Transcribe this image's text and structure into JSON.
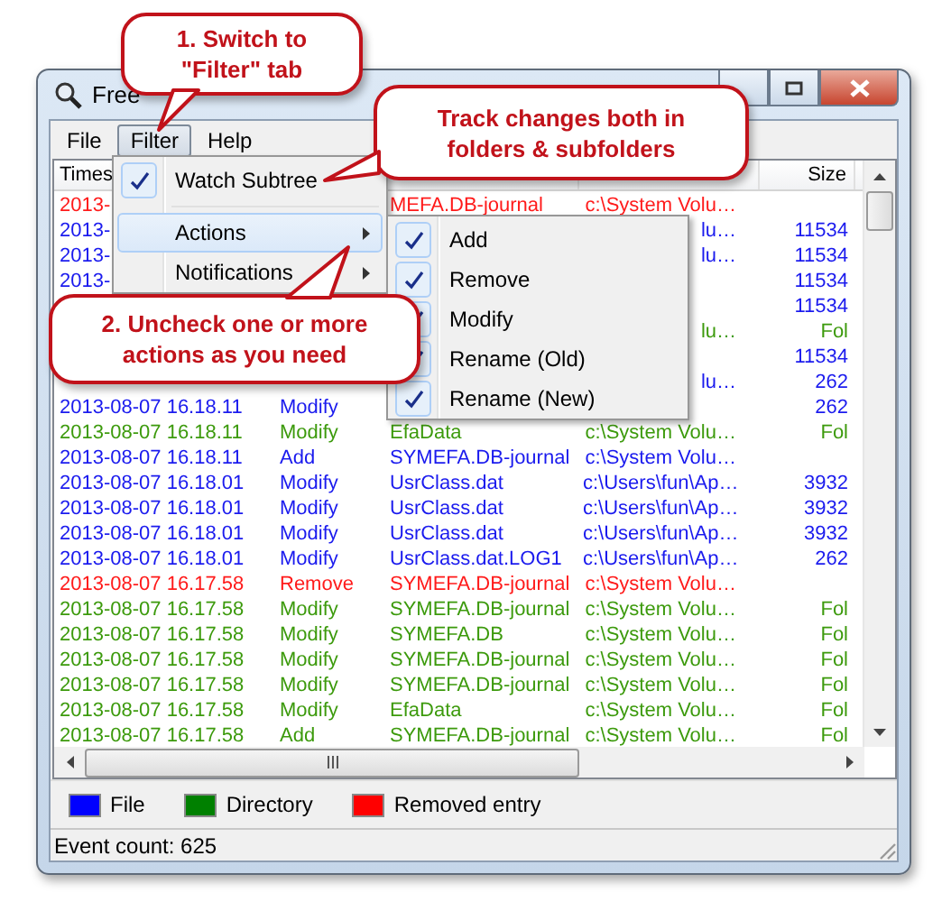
{
  "window": {
    "title": "Free"
  },
  "menu_bar": [
    {
      "label": "File",
      "selected": false
    },
    {
      "label": "Filter",
      "selected": true
    },
    {
      "label": "Help",
      "selected": false
    }
  ],
  "columns": [
    {
      "label": "Times"
    },
    {},
    {},
    {},
    {
      "label": "Size"
    }
  ],
  "rows": [
    {
      "kind": "removed",
      "time": "2013-",
      "name": "MEFA.DB-journal",
      "location": "c:\\System Volu…"
    },
    {
      "kind": "file",
      "time": "2013-",
      "location": "lu…",
      "size": "11534"
    },
    {
      "kind": "file",
      "time": "2013-",
      "location": "lu…",
      "size": "11534"
    },
    {
      "kind": "file",
      "time": "2013-",
      "size": "11534"
    },
    {
      "kind": "file",
      "size": "11534"
    },
    {
      "kind": "directory",
      "location": "lu…",
      "size": "Fol"
    },
    {
      "kind": "file",
      "size": "11534"
    },
    {
      "kind": "file",
      "location": "lu…",
      "size": "262"
    },
    {
      "kind": "file",
      "time": "2013-08-07 16.18.11",
      "action": "Modify",
      "size": "262"
    },
    {
      "kind": "directory",
      "time": "2013-08-07 16.18.11",
      "action": "Modify",
      "name": "EfaData",
      "location": "c:\\System Volu…",
      "size": "Fol"
    },
    {
      "kind": "file",
      "time": "2013-08-07 16.18.11",
      "action": "Add",
      "name": "SYMEFA.DB-journal",
      "location": "c:\\System Volu…"
    },
    {
      "kind": "file",
      "time": "2013-08-07 16.18.01",
      "action": "Modify",
      "name": "UsrClass.dat",
      "location": "c:\\Users\\fun\\Ap…",
      "size": "3932"
    },
    {
      "kind": "file",
      "time": "2013-08-07 16.18.01",
      "action": "Modify",
      "name": "UsrClass.dat",
      "location": "c:\\Users\\fun\\Ap…",
      "size": "3932"
    },
    {
      "kind": "file",
      "time": "2013-08-07 16.18.01",
      "action": "Modify",
      "name": "UsrClass.dat",
      "location": "c:\\Users\\fun\\Ap…",
      "size": "3932"
    },
    {
      "kind": "file",
      "time": "2013-08-07 16.18.01",
      "action": "Modify",
      "name": "UsrClass.dat.LOG1",
      "location": "c:\\Users\\fun\\Ap…",
      "size": "262"
    },
    {
      "kind": "removed",
      "time": "2013-08-07 16.17.58",
      "action": "Remove",
      "name": "SYMEFA.DB-journal",
      "location": "c:\\System Volu…"
    },
    {
      "kind": "directory",
      "time": "2013-08-07 16.17.58",
      "action": "Modify",
      "name": "SYMEFA.DB-journal",
      "location": "c:\\System Volu…",
      "size": "Fol"
    },
    {
      "kind": "directory",
      "time": "2013-08-07 16.17.58",
      "action": "Modify",
      "name": "SYMEFA.DB",
      "location": "c:\\System Volu…",
      "size": "Fol"
    },
    {
      "kind": "directory",
      "time": "2013-08-07 16.17.58",
      "action": "Modify",
      "name": "SYMEFA.DB-journal",
      "location": "c:\\System Volu…",
      "size": "Fol"
    },
    {
      "kind": "directory",
      "time": "2013-08-07 16.17.58",
      "action": "Modify",
      "name": "SYMEFA.DB-journal",
      "location": "c:\\System Volu…",
      "size": "Fol"
    },
    {
      "kind": "directory",
      "time": "2013-08-07 16.17.58",
      "action": "Modify",
      "name": "EfaData",
      "location": "c:\\System Volu…",
      "size": "Fol"
    },
    {
      "kind": "directory",
      "time": "2013-08-07 16.17.58",
      "action": "Add",
      "name": "SYMEFA.DB-journal",
      "location": "c:\\System Volu…",
      "size": "Fol"
    }
  ],
  "legend": [
    {
      "label": "File",
      "color": "#0000ff"
    },
    {
      "label": "Directory",
      "color": "#008000"
    },
    {
      "label": "Removed entry",
      "color": "#ff0000"
    }
  ],
  "status_bar": "Event count: 625",
  "filter_menu": [
    {
      "kind": "check",
      "label": "Watch Subtree",
      "checked": true
    },
    {
      "kind": "separator"
    },
    {
      "kind": "submenu",
      "label": "Actions",
      "selected": true
    },
    {
      "kind": "submenu",
      "label": "Notifications",
      "selected": false
    }
  ],
  "actions_submenu": [
    {
      "label": "Add",
      "checked": true
    },
    {
      "label": "Remove",
      "checked": true
    },
    {
      "label": "Modify",
      "checked": true
    },
    {
      "label": "Rename (Old)",
      "checked": true
    },
    {
      "label": "Rename (New)",
      "checked": true
    }
  ],
  "callouts": [
    "1. Switch to \"Filter\" tab",
    "Track changes both in folders & subfolders",
    "2. Uncheck one or more actions as you need"
  ]
}
